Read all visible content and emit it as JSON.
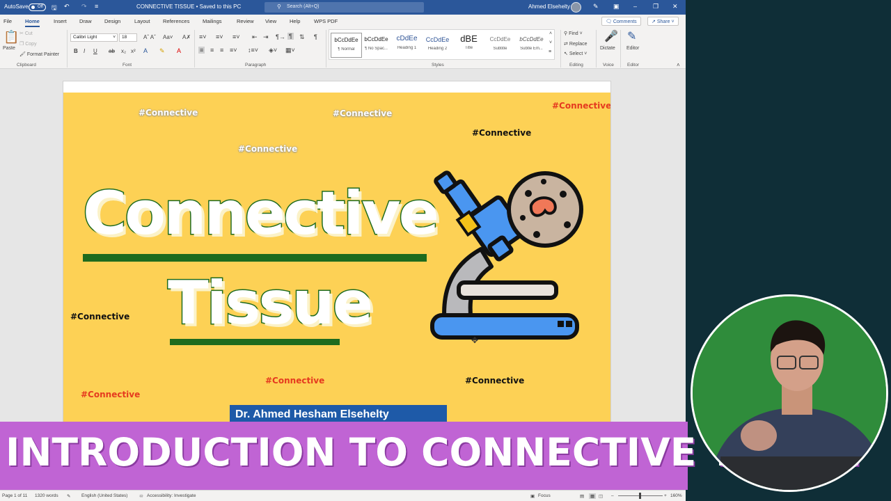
{
  "colors": {
    "word_blue": "#2b579a",
    "poster_yellow": "#fdd155",
    "title_green": "#1e6b1e",
    "banner_purple": "#c064d4",
    "tag_red": "#e53a1f",
    "author_blue": "#1e5aa8"
  },
  "titlebar": {
    "autosave_label": "AutoSave",
    "autosave_state": "Off",
    "doc_title": "CONNECTIVE TISSUE • Saved to this PC",
    "search_placeholder": "Search (Alt+Q)",
    "user_name": "Ahmed Elsehelty"
  },
  "tabs": [
    "File",
    "Home",
    "Insert",
    "Draw",
    "Design",
    "Layout",
    "References",
    "Mailings",
    "Review",
    "View",
    "Help",
    "WPS PDF"
  ],
  "tab_actions": {
    "comments": "Comments",
    "share": "Share"
  },
  "ribbon": {
    "clipboard": {
      "paste": "Paste",
      "cut": "Cut",
      "copy": "Copy",
      "format_painter": "Format Painter",
      "label": "Clipboard"
    },
    "font": {
      "family": "Calibri Light",
      "size": "18",
      "label": "Font"
    },
    "paragraph": {
      "label": "Paragraph"
    },
    "styles": {
      "label": "Styles",
      "items": [
        {
          "sample": "bCcDdEe",
          "name": "¶ Normal"
        },
        {
          "sample": "bCcDdEe",
          "name": "¶ No Spac..."
        },
        {
          "sample": "cDdEe",
          "name": "Heading 1"
        },
        {
          "sample": "CcDdEe",
          "name": "Heading 2"
        },
        {
          "sample": "dBE",
          "name": "Title"
        },
        {
          "sample": "CcDdEe",
          "name": "Subtitle"
        },
        {
          "sample": "bCcDdEe",
          "name": "Subtle Em..."
        }
      ]
    },
    "editing": {
      "find": "Find",
      "replace": "Replace",
      "select": "Select",
      "label": "Editing"
    },
    "voice": {
      "dictate": "Dictate",
      "label": "Voice"
    },
    "editor": {
      "editor": "Editor",
      "label": "Editor"
    }
  },
  "poster": {
    "tags": [
      "#Connective",
      "#Connective",
      "#Connective",
      "#Connective",
      "#Connective",
      "#Connective",
      "#Connective",
      "#Connective",
      "#Connective"
    ],
    "title_line1": "Connective",
    "title_line2": "Tissue",
    "author": "Dr. Ahmed Hesham Elsehelty"
  },
  "banner": {
    "text": "INTRODUCTION TO CONNECTIVE TISSUE"
  },
  "status": {
    "page": "Page 1 of 11",
    "words": "1320 words",
    "language": "English (United States)",
    "accessibility": "Accessibility: Investigate",
    "focus": "Focus",
    "zoom": "160%"
  }
}
